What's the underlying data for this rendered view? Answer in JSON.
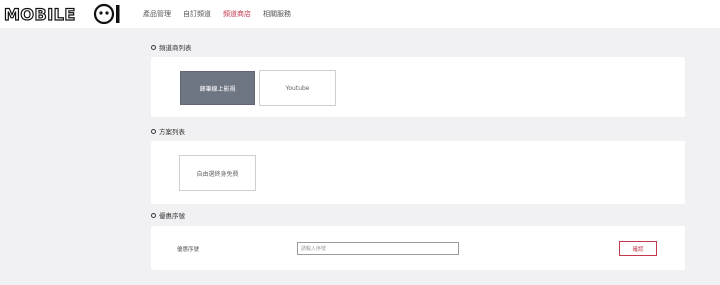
{
  "logo": {
    "text": "MOBILE01"
  },
  "nav": {
    "items": [
      {
        "label": "產品管理"
      },
      {
        "label": "自訂頻道"
      },
      {
        "label": "頻道商店"
      },
      {
        "label": "相關服務"
      }
    ]
  },
  "sections": {
    "channels": {
      "title": "頻道商列表",
      "tiles": [
        {
          "label": "鋒筆線上影視"
        },
        {
          "label": "Youtube"
        }
      ]
    },
    "plans": {
      "title": "方案列表",
      "tiles": [
        {
          "label": "自由選終身免費"
        }
      ]
    },
    "coupon": {
      "title": "優惠序號",
      "field_label": "優惠序號",
      "placeholder": "請輸入序號",
      "confirm_label": "確認"
    }
  },
  "colors": {
    "accent": "#c4384e",
    "selected_tile": "#6f7683",
    "background": "#f1f1f3"
  }
}
